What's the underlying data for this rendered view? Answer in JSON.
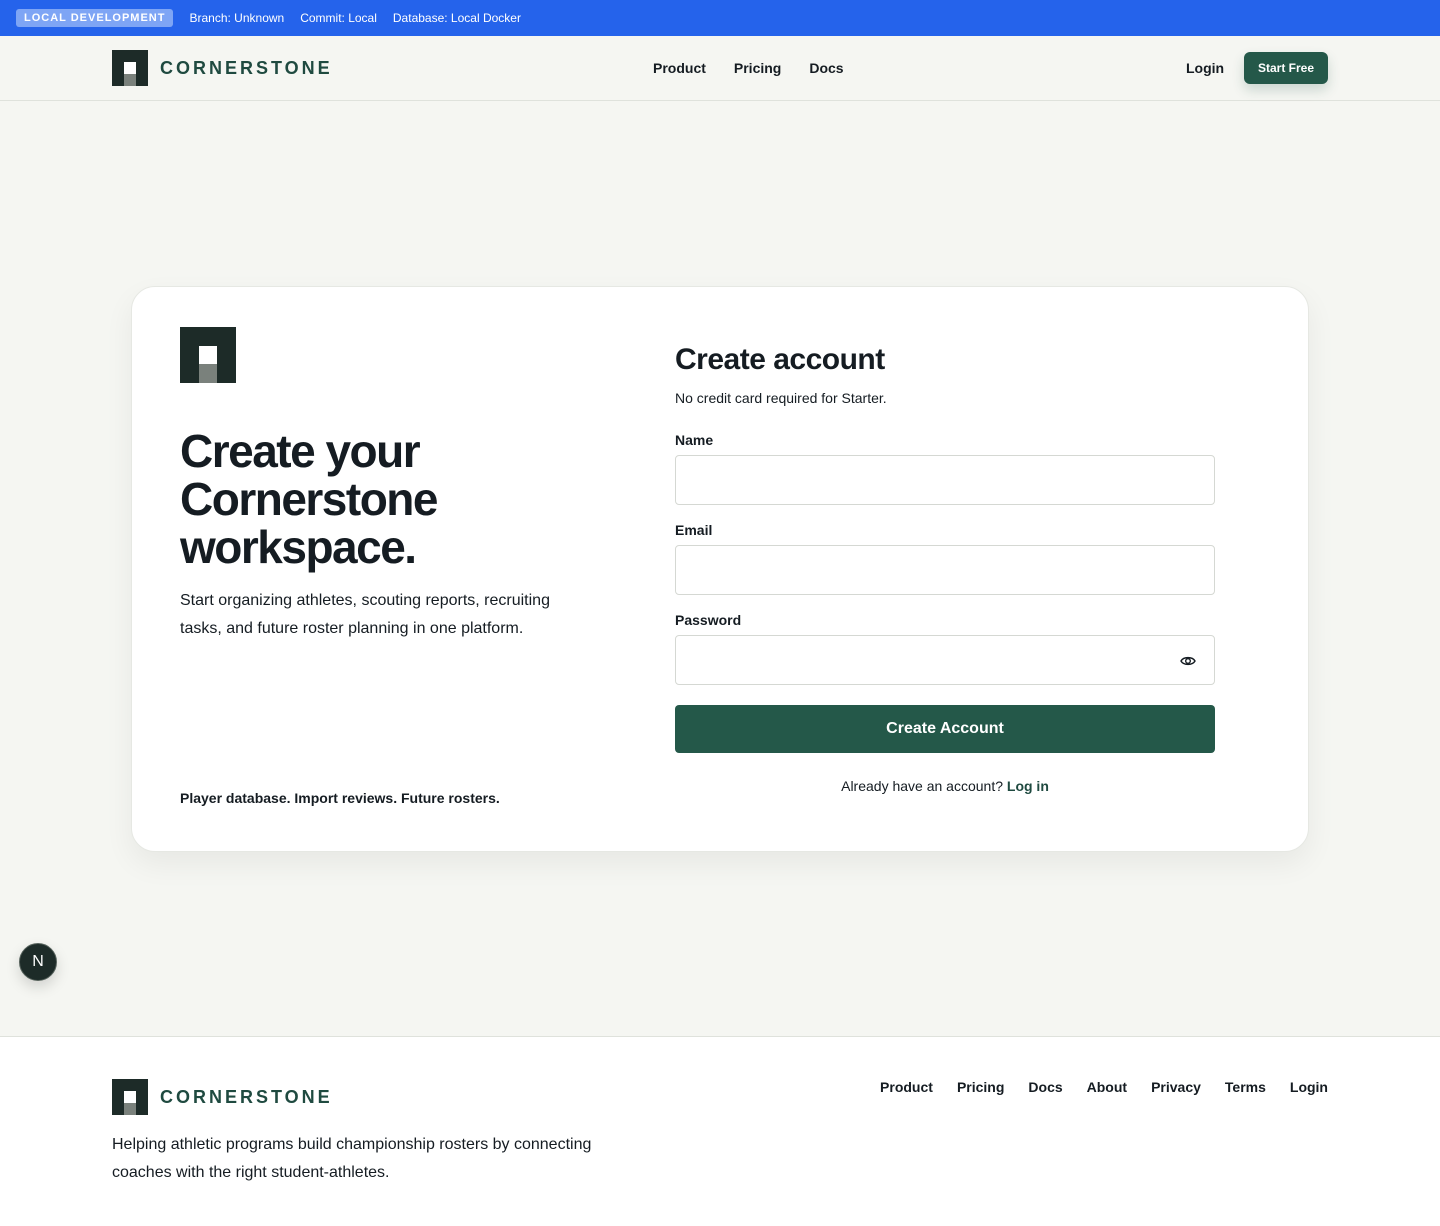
{
  "dev_bar": {
    "badge": "LOCAL DEVELOPMENT",
    "branch": "Branch: Unknown",
    "commit": "Commit: Local",
    "database": "Database: Local Docker"
  },
  "header": {
    "brand": "CORNERSTONE",
    "nav": [
      "Product",
      "Pricing",
      "Docs"
    ],
    "login": "Login",
    "cta": "Start Free"
  },
  "hero": {
    "title": "Create your Cornerstone workspace.",
    "body": "Start organizing athletes, scouting reports, recruiting tasks, and future roster planning in one platform.",
    "tagline": "Player database. Import reviews. Future rosters."
  },
  "form": {
    "title": "Create account",
    "subtitle": "No credit card required for Starter.",
    "name_label": "Name",
    "name_value": "",
    "email_label": "Email",
    "email_value": "",
    "password_label": "Password",
    "password_value": "",
    "submit": "Create Account",
    "signin_prompt": "Already have an account?",
    "signin_link": "Log in"
  },
  "dev_indicator": "N",
  "footer": {
    "brand": "CORNERSTONE",
    "tagline": "Helping athletic programs build championship rosters by connecting coaches with the right student-athletes.",
    "nav": [
      "Product",
      "Pricing",
      "Docs",
      "About",
      "Privacy",
      "Terms",
      "Login"
    ]
  },
  "colors": {
    "dev_bar": "#2563eb",
    "brand_dark": "#1d2b28",
    "primary_green": "#245849",
    "background": "#f5f6f2"
  },
  "icons": {
    "password_toggle": "eye-icon",
    "brand_mark": "cornerstone-logo-icon"
  }
}
